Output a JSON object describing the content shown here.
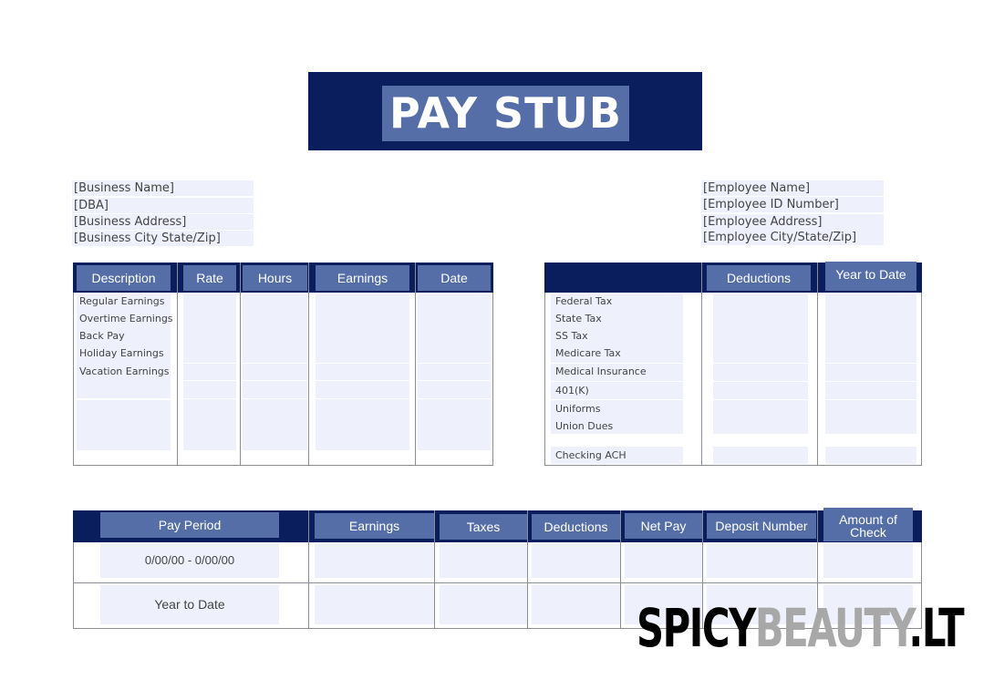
{
  "title": "PAY STUB",
  "business": [
    "[Business Name]",
    "[DBA]",
    "[Business Address]",
    "[Business City State/Zip]"
  ],
  "employee": [
    "[Employee Name]",
    "[Employee ID Number]",
    "[Employee Address]",
    "[Employee City/State/Zip]"
  ],
  "earnings_table": {
    "headers": [
      "Description",
      "Rate",
      "Hours",
      "Earnings",
      "Date"
    ],
    "rows": [
      "Regular Earnings",
      "Overtime Earnings",
      "Back Pay",
      "Holiday Earnings",
      "Vacation Earnings"
    ]
  },
  "deductions_table": {
    "headers": [
      "Deductions",
      "Year to Date"
    ],
    "rows": [
      "Federal Tax",
      "State Tax",
      "SS Tax",
      "Medicare Tax",
      "Medical Insurance",
      "401(K)",
      "Uniforms",
      "Union Dues",
      "Checking ACH"
    ]
  },
  "summary_table": {
    "headers": [
      "Pay Period",
      "Earnings",
      "Taxes",
      "Deductions",
      "Net Pay",
      "Deposit Number",
      "Amount of Check"
    ],
    "rows": [
      "0/00/00 - 0/00/00",
      "Year to Date"
    ]
  },
  "watermark": {
    "part1": "SPICY",
    "part2": "BEAUTY",
    "part3": ".LT"
  }
}
